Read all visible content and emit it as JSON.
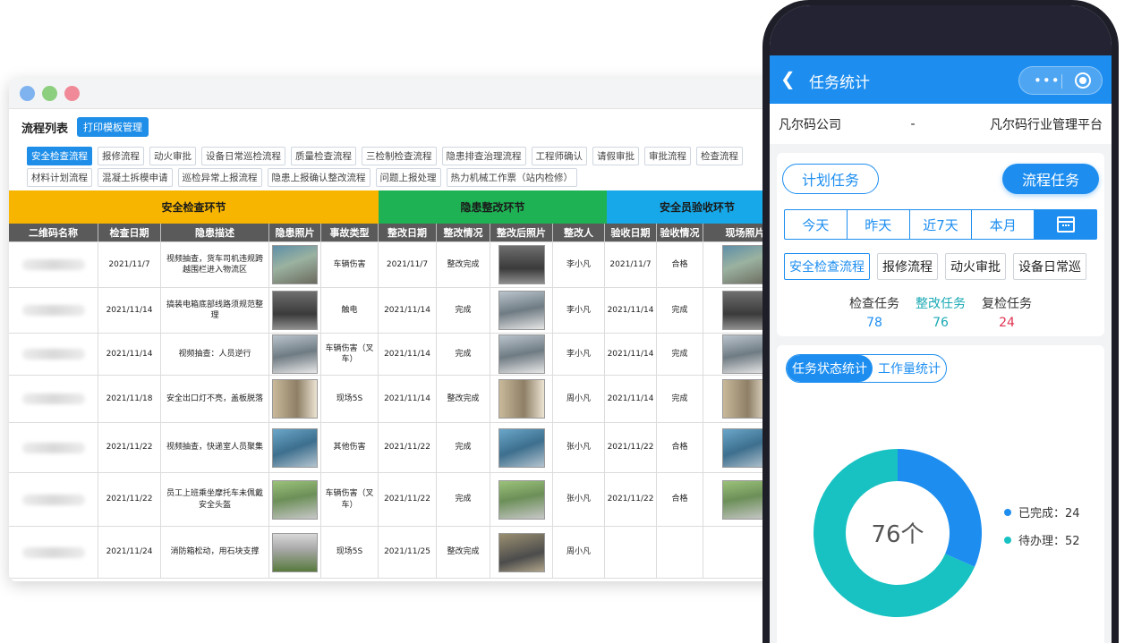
{
  "desktop": {
    "process_list_title": "流程列表",
    "print_template_btn": "打印模板管理",
    "chips_row1": [
      "安全检查流程",
      "报修流程",
      "动火审批",
      "设备日常巡检流程",
      "质量检查流程",
      "三检制检查流程",
      "隐患排查治理流程",
      "工程师确认",
      "请假审批",
      "审批流程",
      "检查流程"
    ],
    "chips_row2": [
      "材料计划流程",
      "混凝土拆模申请",
      "巡检异常上报流程",
      "隐患上报确认整改流程",
      "问题上报处理",
      "热力机械工作票（站内检修）"
    ],
    "sections": [
      "安全检查环节",
      "隐患整改环节",
      "安全员验收环节"
    ],
    "headers": [
      "二维码名称",
      "检查日期",
      "隐患描述",
      "隐患照片",
      "事故类型",
      "整改日期",
      "整改情况",
      "整改后照片",
      "整改人",
      "验收日期",
      "验收情况",
      "现场照片"
    ],
    "rows": [
      {
        "date": "2021/11/7",
        "desc": "视频抽查，货车司机违规跨越围栏进入物流区",
        "type": "车辆伤害",
        "fix_date": "2021/11/7",
        "fix_status": "整改完成",
        "person": "李小凡",
        "acc_date": "2021/11/7",
        "acc_status": "合格"
      },
      {
        "date": "2021/11/14",
        "desc": "搞装电箱底部线路须规范整理",
        "type": "触电",
        "fix_date": "2021/11/14",
        "fix_status": "完成",
        "person": "李小凡",
        "acc_date": "2021/11/14",
        "acc_status": "完成"
      },
      {
        "date": "2021/11/14",
        "desc": "视频抽查：人员逆行",
        "type": "车辆伤害（叉车）",
        "fix_date": "2021/11/14",
        "fix_status": "完成",
        "person": "李小凡",
        "acc_date": "2021/11/14",
        "acc_status": "完成"
      },
      {
        "date": "2021/11/18",
        "desc": "安全出口灯不亮，盖板脱落",
        "type": "现场5S",
        "fix_date": "2021/11/14",
        "fix_status": "整改完成",
        "person": "周小凡",
        "acc_date": "2021/11/14",
        "acc_status": "完成"
      },
      {
        "date": "2021/11/22",
        "desc": "视频抽查，快递室人员聚集",
        "type": "其他伤害",
        "fix_date": "2021/11/22",
        "fix_status": "完成",
        "person": "张小凡",
        "acc_date": "2021/11/22",
        "acc_status": "合格"
      },
      {
        "date": "2021/11/22",
        "desc": "员工上班乘坐摩托车未佩戴安全头盔",
        "type": "车辆伤害（叉车）",
        "fix_date": "2021/11/22",
        "fix_status": "完成",
        "person": "张小凡",
        "acc_date": "2021/11/22",
        "acc_status": "合格"
      },
      {
        "date": "2021/11/24",
        "desc": "消防箱松动，用石块支撑",
        "type": "现场5S",
        "fix_date": "2021/11/25",
        "fix_status": "整改完成",
        "person": "周小凡",
        "acc_date": "",
        "acc_status": ""
      }
    ]
  },
  "phone": {
    "nav_title": "任务统计",
    "company_left": "凡尔码公司",
    "company_dash": "-",
    "company_right": "凡尔码行业管理平台",
    "plan_task": "计划任务",
    "process_task": "流程任务",
    "ranges": [
      "今天",
      "昨天",
      "近7天",
      "本月"
    ],
    "flow_tabs": [
      "安全检查流程",
      "报修流程",
      "动火审批",
      "设备日常巡"
    ],
    "stats": [
      {
        "label": "检查任务",
        "value": "78"
      },
      {
        "label": "整改任务",
        "value": "76"
      },
      {
        "label": "复检任务",
        "value": "24"
      }
    ],
    "tab_status": "任务状态统计",
    "tab_workload": "工作量统计",
    "donut_center": "76个",
    "legend": [
      {
        "label": "已完成：24",
        "color": "#1d8ef0"
      },
      {
        "label": "待办理：52",
        "color": "#19c2c2"
      }
    ]
  },
  "chart_data": {
    "type": "pie",
    "categories": [
      "已完成",
      "待办理"
    ],
    "values": [
      24,
      52
    ],
    "title": "",
    "total_label": "76个"
  }
}
